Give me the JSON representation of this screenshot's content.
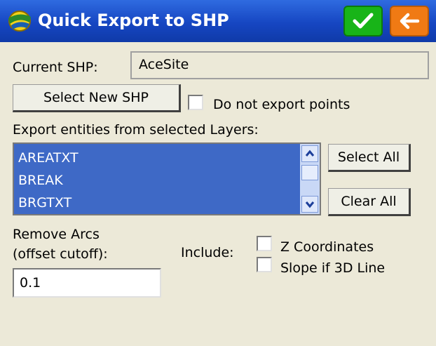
{
  "window": {
    "title": "Quick Export to SHP"
  },
  "current_shp": {
    "label": "Current SHP:",
    "value": "AceSite"
  },
  "select_new_shp_label": "Select New SHP",
  "do_not_export_points": {
    "label": "Do not export points",
    "checked": false
  },
  "layers": {
    "label": "Export entities from selected Layers:",
    "items": [
      "AREATXT",
      "BREAK",
      "BRGTXT"
    ],
    "select_all_label": "Select All",
    "clear_all_label": "Clear All"
  },
  "remove_arcs": {
    "label_line1": "Remove Arcs",
    "label_line2": "(offset cutoff):",
    "value": "0.1"
  },
  "include": {
    "label": "Include:",
    "z_coordinates": {
      "label": "Z Coordinates",
      "checked": false
    },
    "slope_3d": {
      "label": "Slope if 3D Line",
      "checked": false
    }
  },
  "icons": {
    "app": "app-logo-icon",
    "ok": "checkmark-icon",
    "back": "arrow-left-icon"
  },
  "colors": {
    "title_bar": "#1646c2",
    "ok_button": "#18b418",
    "back_button": "#f07a14",
    "list_selected": "#3e69c6"
  }
}
